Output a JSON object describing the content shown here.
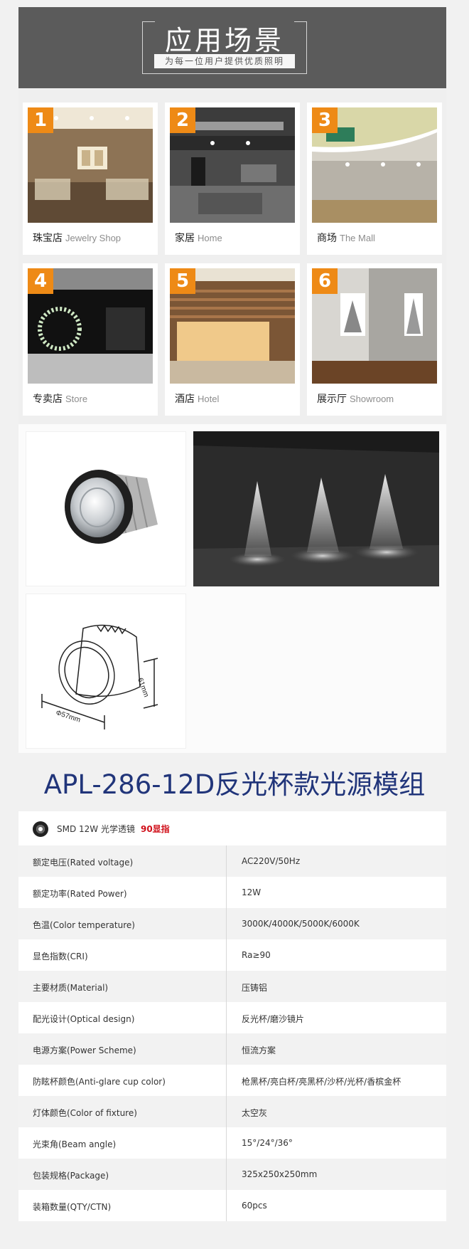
{
  "banner": {
    "title": "应用场景",
    "subtitle": "为每一位用户提供优质照明"
  },
  "scenes": [
    {
      "num": "1",
      "zh": "珠宝店",
      "en": "Jewelry Shop"
    },
    {
      "num": "2",
      "zh": "家居",
      "en": "Home"
    },
    {
      "num": "3",
      "zh": "商场",
      "en": "The Mall"
    },
    {
      "num": "4",
      "zh": "专卖店",
      "en": "Store"
    },
    {
      "num": "5",
      "zh": "酒店",
      "en": "Hotel"
    },
    {
      "num": "6",
      "zh": "展示厅",
      "en": "Showroom"
    }
  ],
  "product": {
    "dim_height": "61mm",
    "dim_diameter": "Φ57mm"
  },
  "model_title": "APL-286-12D反光杯款光源模组",
  "spec": {
    "header_text": "SMD 12W 光学透镜",
    "header_highlight": "90显指",
    "rows": [
      {
        "k": "额定电压(Rated voltage)",
        "v": "AC220V/50Hz"
      },
      {
        "k": "额定功率(Rated Power)",
        "v": "12W"
      },
      {
        "k": "色温(Color temperature)",
        "v": "3000K/4000K/5000K/6000K"
      },
      {
        "k": "显色指数(CRI)",
        "v": "Ra≥90"
      },
      {
        "k": "主要材质(Material)",
        "v": "压铸铝"
      },
      {
        "k": "配光设计(Optical design)",
        "v": "反光杯/磨沙镜片"
      },
      {
        "k": "电源方案(Power Scheme)",
        "v": "恒流方案"
      },
      {
        "k": "防眩杯颜色(Anti-glare cup color)",
        "v": "枪黑杯/亮白杯/亮黑杯/沙杯/光杯/香槟金杯"
      },
      {
        "k": "灯体颜色(Color of fixture)",
        "v": "太空灰"
      },
      {
        "k": "光束角(Beam angle)",
        "v": "15°/24°/36°"
      },
      {
        "k": "包装规格(Package)",
        "v": "325x250x250mm"
      },
      {
        "k": "装箱数量(QTY/CTN)",
        "v": "60pcs"
      }
    ]
  }
}
